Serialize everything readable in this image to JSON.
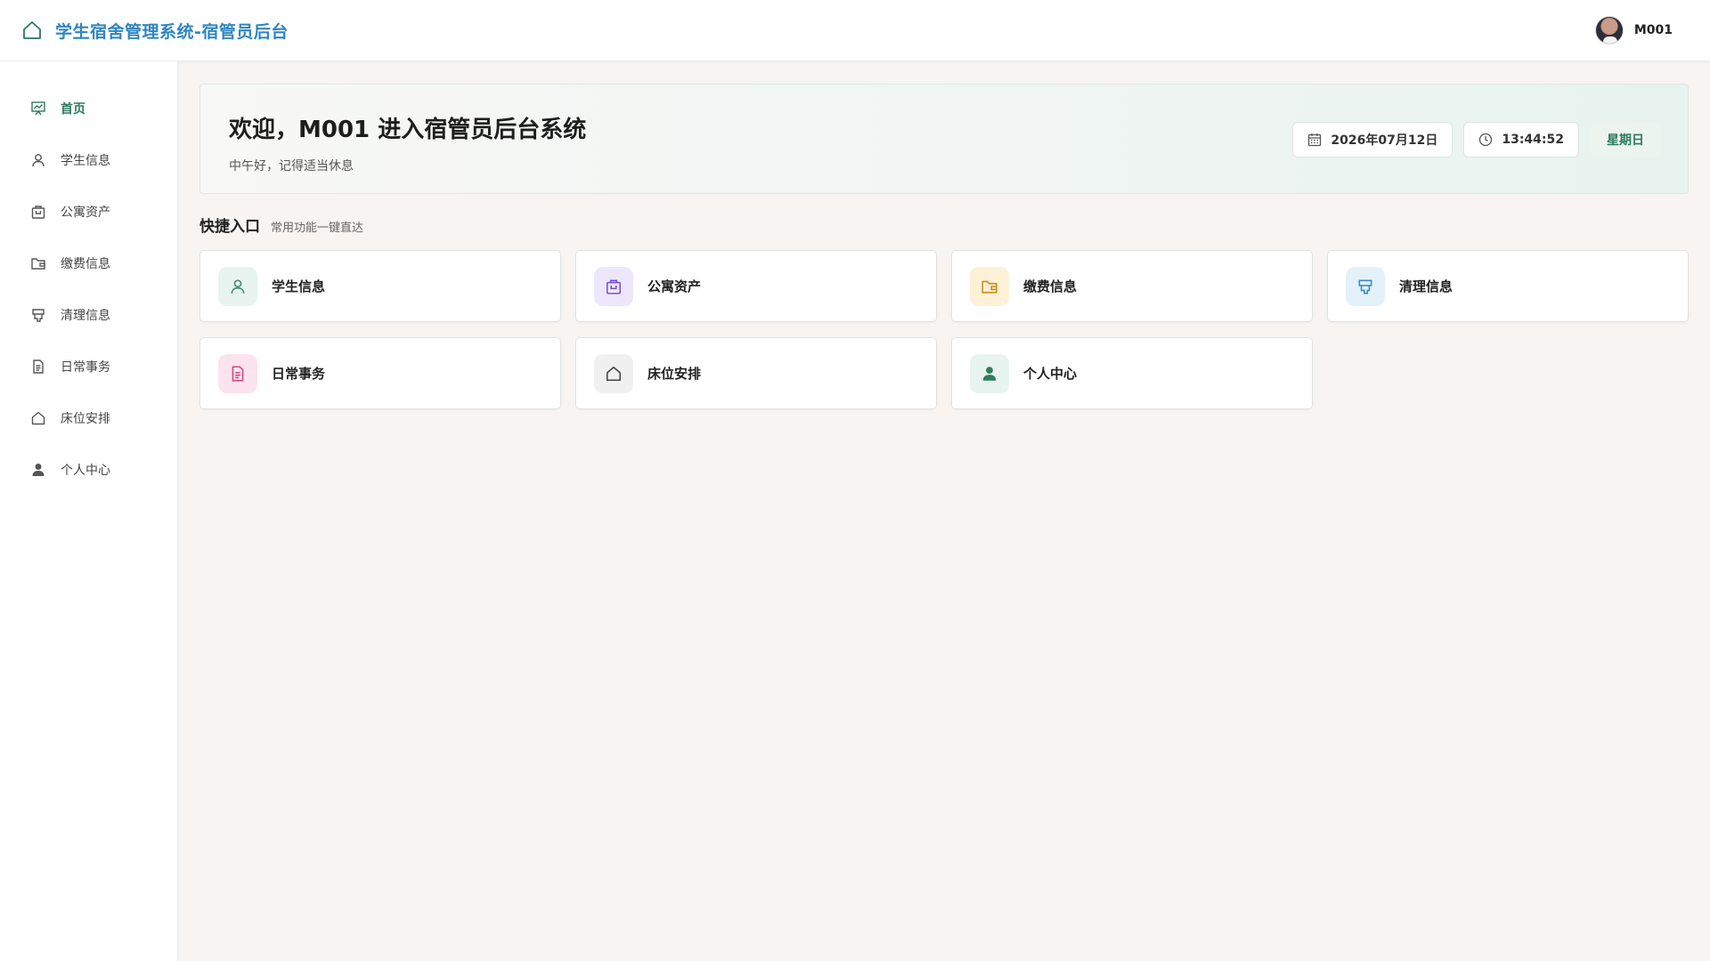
{
  "header": {
    "title": "学生宿舍管理系统-宿管员后台",
    "user_name": "M001"
  },
  "sidebar": {
    "items": [
      {
        "label": "首页",
        "icon": "home-chart-icon",
        "active": true
      },
      {
        "label": "学生信息",
        "icon": "user-icon"
      },
      {
        "label": "公寓资产",
        "icon": "box-icon"
      },
      {
        "label": "缴费信息",
        "icon": "wallet-icon"
      },
      {
        "label": "清理信息",
        "icon": "cleaning-icon"
      },
      {
        "label": "日常事务",
        "icon": "document-icon"
      },
      {
        "label": "床位安排",
        "icon": "house-icon"
      },
      {
        "label": "个人中心",
        "icon": "person-filled-icon"
      }
    ]
  },
  "welcome": {
    "title": "欢迎，M001 进入宿管员后台系统",
    "subtitle": "中午好，记得适当休息",
    "date": "2026年07月12日",
    "time": "13:44:52",
    "weekday": "星期日"
  },
  "quick": {
    "title": "快捷入口",
    "subtitle": "常用功能一键直达",
    "cards": [
      {
        "label": "学生信息",
        "icon": "user-icon",
        "bg": "#e8f4ef",
        "fg": "#3d8a6a"
      },
      {
        "label": "公寓资产",
        "icon": "box-icon",
        "bg": "#ede7fb",
        "fg": "#7b4fd0"
      },
      {
        "label": "缴费信息",
        "icon": "wallet-icon",
        "bg": "#fdf1d6",
        "fg": "#c98a1a"
      },
      {
        "label": "清理信息",
        "icon": "cleaning-icon",
        "bg": "#e3f1fb",
        "fg": "#3b88c4"
      },
      {
        "label": "日常事务",
        "icon": "document-icon",
        "bg": "#fce4ee",
        "fg": "#d2447f"
      },
      {
        "label": "床位安排",
        "icon": "house-icon",
        "bg": "#f0f0f0",
        "fg": "#444444"
      },
      {
        "label": "个人中心",
        "icon": "person-filled-icon",
        "bg": "#e8f4ef",
        "fg": "#2f7d5e"
      }
    ]
  },
  "colors": {
    "brand": "#2e86c1",
    "accent": "#2b7a5c"
  }
}
